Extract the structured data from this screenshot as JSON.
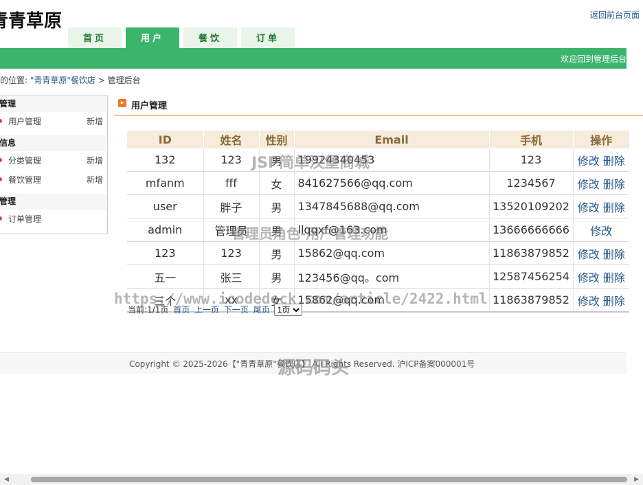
{
  "header": {
    "site_title": "青青草原",
    "back_link": "返回前台页面",
    "welcome": "欢迎回到管理后台"
  },
  "nav": {
    "tabs": [
      "首页",
      "用户",
      "餐饮",
      "订单"
    ],
    "active": "用户"
  },
  "breadcrumb": {
    "prefix": "在的位置:",
    "shop": "\"青青草原\"餐饮店",
    "separator": ">",
    "current": "管理后台"
  },
  "sidebar": {
    "group1": "户管理",
    "item_user": "用户管理",
    "item_user_add": "新增",
    "group2": "饮信息",
    "item_category": "分类管理",
    "item_category_add": "新增",
    "item_food": "餐饮管理",
    "item_food_add": "新增",
    "group3": "单管理",
    "item_order": "订单管理"
  },
  "panel": {
    "title": "用户管理"
  },
  "table": {
    "headers": [
      "ID",
      "姓名",
      "性别",
      "Email",
      "手机",
      "操作"
    ],
    "rows": [
      [
        "132",
        "123",
        "男",
        "19924340453",
        "123",
        "修改",
        "删除"
      ],
      [
        "mfanm",
        "fff",
        "女",
        "841627566@qq.com",
        "1234567",
        "修改",
        "删除"
      ],
      [
        "user",
        "胖子",
        "男",
        "1347845688@qq.com",
        "13520109202",
        "修改",
        "删除"
      ],
      [
        "admin",
        "管理员",
        "男",
        "llqqxf@163.com",
        "13666666666",
        "修改",
        ""
      ],
      [
        "123",
        "123",
        "男",
        "15862@qq.com",
        "11863879852",
        "修改",
        "删除"
      ],
      [
        "五一",
        "张三",
        "男",
        "123456@qq。com",
        "12587456254",
        "修改",
        "删除"
      ],
      [
        "三个",
        "xx",
        "女",
        "15862@qq.com",
        "11863879852",
        "修改",
        "删除"
      ]
    ]
  },
  "pager": {
    "current": "当前:1/1页",
    "first": "首页",
    "prev": "上一页",
    "next": "下一页",
    "last": "尾页",
    "select_value": "1页"
  },
  "footer": {
    "text": "Copyright © 2025-2026【\"青青草原\"餐饮店】 All Rights Reserved. 沪ICP备案000001号"
  },
  "watermarks": {
    "w1": "JSP简单汉堡商城",
    "w2": "管理员角色-用户管理功能",
    "w3": "https://www.icodedock.com/article/2422.html",
    "w4": "源码码头"
  },
  "icons": {
    "panel_icon": "arrow-right-icon",
    "bullet": "dot-icon"
  },
  "colors": {
    "primary_green": "#3cb46c",
    "link_blue": "#2a5a8a",
    "table_header_bg": "#f5ecdc",
    "bullet_pink": "#e0357a"
  }
}
